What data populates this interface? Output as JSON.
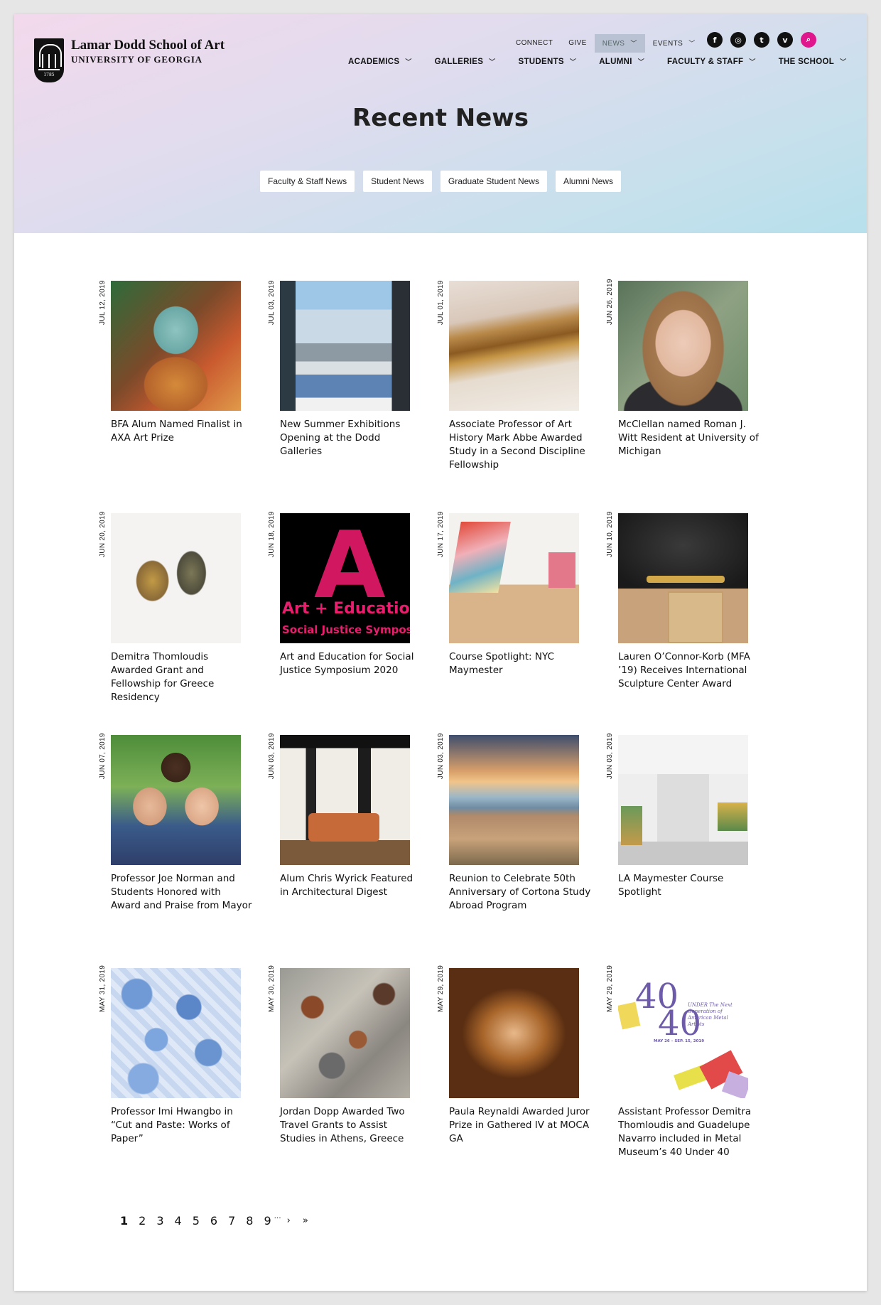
{
  "brand": {
    "name": "Lamar Dodd School of Art",
    "subtitle": "UNIVERSITY OF GEORGIA",
    "logo_year": "1785"
  },
  "utility_nav": [
    {
      "label": "CONNECT",
      "active": false
    },
    {
      "label": "GIVE",
      "active": false
    },
    {
      "label": "NEWS",
      "active": true,
      "dropdown": true
    },
    {
      "label": "EVENTS",
      "active": false,
      "dropdown": true
    }
  ],
  "social": [
    {
      "icon": "facebook-icon",
      "glyph": "f"
    },
    {
      "icon": "instagram-icon",
      "glyph": "◎"
    },
    {
      "icon": "twitter-icon",
      "glyph": "t"
    },
    {
      "icon": "vimeo-icon",
      "glyph": "v"
    },
    {
      "icon": "search-icon",
      "glyph": "⌕"
    }
  ],
  "main_nav": [
    "ACADEMICS",
    "GALLERIES",
    "STUDENTS",
    "ALUMNI",
    "FACULTY & STAFF",
    "THE SCHOOL"
  ],
  "page_title": "Recent News",
  "filters": [
    "Faculty & Staff News",
    "Student News",
    "Graduate Student News",
    "Alumni News"
  ],
  "news": [
    {
      "date": "JUL 12, 2019",
      "title": "BFA Alum Named Finalist in AXA Art Prize"
    },
    {
      "date": "JUL 03, 2019",
      "title": "New Summer Exhibitions Opening at the Dodd Galleries"
    },
    {
      "date": "JUL 01, 2019",
      "title": "Associate Professor of Art History Mark Abbe Awarded Study in a Second Discipline Fellowship"
    },
    {
      "date": "JUN 26, 2019",
      "title": "McClellan named Roman J. Witt Resident at University of Michigan"
    },
    {
      "date": "JUN 20, 2019",
      "title": "Demitra Thomloudis Awarded Grant and Fellowship for Greece Residency"
    },
    {
      "date": "JUN 18, 2019",
      "title": "Art and Education for Social Justice Symposium 2020"
    },
    {
      "date": "JUN 17, 2019",
      "title": "Course Spotlight: NYC Maymester"
    },
    {
      "date": "JUN 10, 2019",
      "title": "Lauren O’Connor-Korb (MFA ’19) Receives International Sculpture Center Award"
    },
    {
      "date": "JUN 07, 2019",
      "title": "Professor Joe Norman and Students Honored with Award and Praise from Mayor"
    },
    {
      "date": "JUN 03, 2019",
      "title": "Alum Chris Wyrick Featured in Architectural Digest"
    },
    {
      "date": "JUN 03, 2019",
      "title": "Reunion to Celebrate 50th Anniversary of Cortona Study Abroad Program"
    },
    {
      "date": "JUN 03, 2019",
      "title": "LA Maymester Course Spotlight"
    },
    {
      "date": "MAY 31, 2019",
      "title": "Professor Imi Hwangbo in “Cut and Paste: Works of Paper”"
    },
    {
      "date": "MAY 30, 2019",
      "title": "Jordan Dopp Awarded Two Travel Grants to Assist Studies in Athens, Greece"
    },
    {
      "date": "MAY 29, 2019",
      "title": "Paula Reynaldi Awarded Juror Prize in Gathered IV at MOCA GA"
    },
    {
      "date": "MAY 29, 2019",
      "title": "Assistant Professor Demitra Thomloudis and Guadelupe Navarro included in Metal Museum’s 40 Under 40"
    }
  ],
  "thumb_text": {
    "art_letter": "A",
    "art_line1": "Art + Education",
    "art_line2": "Social Justice Sympos",
    "museum_num1": "40",
    "museum_num2": "40",
    "museum_sub": "UNDER   The Next Generation of American Metal Artists",
    "museum_dates": "MAY 26 – SEP. 15, 2019"
  },
  "pagination": {
    "pages": [
      "1",
      "2",
      "3",
      "4",
      "5",
      "6",
      "7",
      "8",
      "9"
    ],
    "current": "1",
    "ellipsis": "…",
    "next": "›",
    "last": "»"
  }
}
